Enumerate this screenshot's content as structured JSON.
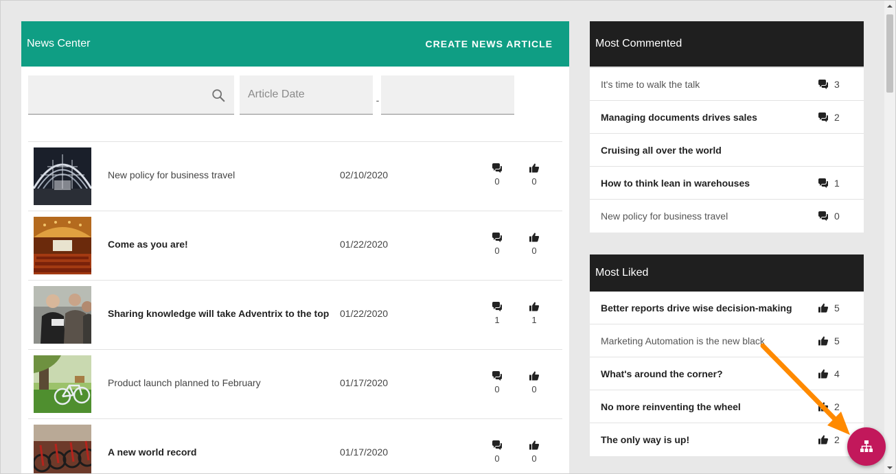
{
  "news": {
    "title": "News Center",
    "create_label": "CREATE NEWS ARTICLE",
    "search_placeholder": "",
    "date_placeholder": "Article Date",
    "date_separator": "-",
    "articles": [
      {
        "title": "New policy for business travel",
        "bold": false,
        "date": "02/10/2020",
        "comments": "0",
        "likes": "0",
        "thumb": "station"
      },
      {
        "title": "Come as you are!",
        "bold": true,
        "date": "01/22/2020",
        "comments": "0",
        "likes": "0",
        "thumb": "theater"
      },
      {
        "title": "Sharing knowledge will take Adventrix to the top",
        "bold": true,
        "date": "01/22/2020",
        "comments": "1",
        "likes": "1",
        "thumb": "people"
      },
      {
        "title": "Product launch planned to February",
        "bold": false,
        "date": "01/17/2020",
        "comments": "0",
        "likes": "0",
        "thumb": "bicycle"
      },
      {
        "title": "A new world record",
        "bold": true,
        "date": "01/17/2020",
        "comments": "0",
        "likes": "0",
        "thumb": "bikes"
      }
    ]
  },
  "most_commented": {
    "title": "Most Commented",
    "items": [
      {
        "title": "It's time to walk the talk",
        "bold": false,
        "count": "3"
      },
      {
        "title": "Managing documents drives sales",
        "bold": true,
        "count": "2"
      },
      {
        "title": "Cruising all over the world",
        "bold": true,
        "count": ""
      },
      {
        "title": "How to think lean in warehouses",
        "bold": true,
        "count": "1"
      },
      {
        "title": "New policy for business travel",
        "bold": false,
        "count": "0"
      }
    ]
  },
  "most_liked": {
    "title": "Most Liked",
    "items": [
      {
        "title": "Better reports drive wise decision-making",
        "bold": true,
        "count": "5"
      },
      {
        "title": "Marketing Automation is the new black",
        "bold": false,
        "count": "5"
      },
      {
        "title": "What's around the corner?",
        "bold": true,
        "count": "4"
      },
      {
        "title": "No more reinventing the wheel",
        "bold": true,
        "count": "2"
      },
      {
        "title": "The only way is up!",
        "bold": true,
        "count": "2"
      }
    ]
  },
  "colors": {
    "header_green": "#0f9e84",
    "header_dark": "#1f1f1f",
    "fab": "#c2185b",
    "arrow": "#ff8a00"
  },
  "icons": {
    "comment": "comment-icon",
    "like": "thumbs-up-icon",
    "search": "search-icon",
    "fab": "sitemap-icon"
  }
}
